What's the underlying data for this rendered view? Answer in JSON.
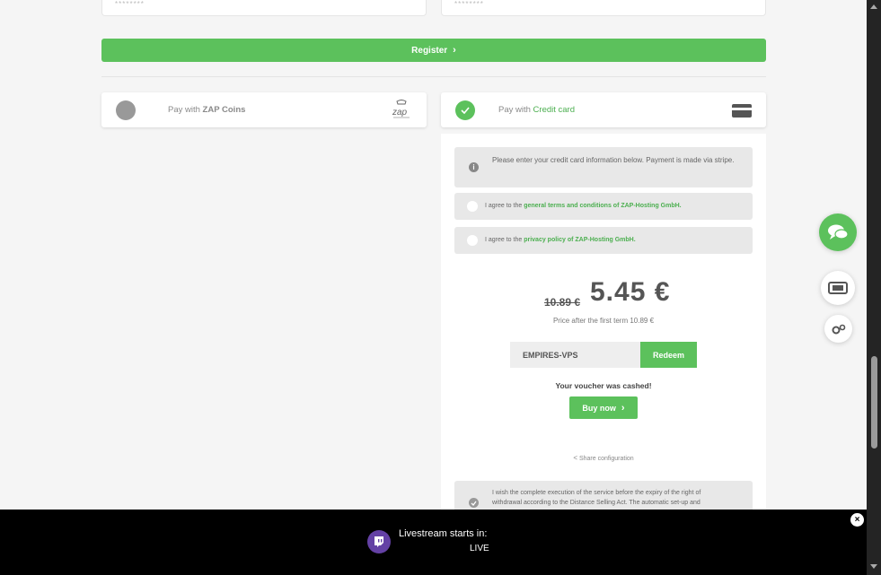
{
  "form": {
    "password_mask": "********",
    "password_confirm_mask": "********",
    "register_label": "Register"
  },
  "payment": {
    "zap": {
      "prefix": "Pay with",
      "name": "ZAP Coins",
      "logo_text": "zap"
    },
    "credit": {
      "prefix": "Pay with",
      "name": "Credit card"
    }
  },
  "cc": {
    "info_text": "Please enter your credit card information below. Payment is made via stripe.",
    "terms_prefix": "I agree to the",
    "terms_link": "general terms and conditions of ZAP-Hosting GmbH.",
    "privacy_prefix": "I agree to the",
    "privacy_link": "privacy policy of ZAP-Hosting GmbH.",
    "old_price": "10.89 €",
    "new_price": "5.45 €",
    "price_after": "Price after the first term 10.89 €",
    "voucher_code": "EMPIRES-VPS",
    "redeem_label": "Redeem",
    "voucher_cashed": "Your voucher was cashed!",
    "buy_label": "Buy now",
    "share_label": "Share configuration",
    "withdrawal_text": "I wish the complete execution of the service before the expiry of the right of withdrawal according to the Distance Selling Act. The automatic set-up and"
  },
  "livestream": {
    "title": "Livestream starts in:",
    "status": "LIVE"
  },
  "colors": {
    "accent": "#5cc15c",
    "twitch": "#6441a5"
  }
}
